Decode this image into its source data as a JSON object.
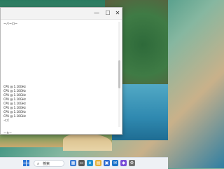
{
  "window": {
    "controls": {
      "minimize": "—",
      "maximize": "☐",
      "close": "✕"
    },
    "lines": [
      "ーバーロー",
      "",
      "",
      "",
      "",
      "",
      "",
      "",
      "",
      "",
      "",
      "",
      "",
      "",
      "",
      "CPU @ 1.10GHz",
      "CPU @ 1.10GHz",
      "CPU @ 1.10GHz",
      "CPU @ 1.10GHz",
      "CPU @ 1.10GHz",
      "CPU @ 1.10GHz",
      "CPU @ 1.10GHz",
      "CPU @ 1.10GHz",
      "イズ",
      "",
      "",
      "ーカー"
    ]
  },
  "taskbar": {
    "search_label": "検索",
    "icons": [
      {
        "name": "widgets-icon",
        "glyph": "▦",
        "color": "#3a7bd5"
      },
      {
        "name": "task-view-icon",
        "glyph": "▭",
        "color": "#5a5a5a"
      },
      {
        "name": "edge-icon",
        "glyph": "e",
        "color": "#1f8fd0"
      },
      {
        "name": "explorer-icon",
        "glyph": "▤",
        "color": "#e8b13a"
      },
      {
        "name": "store-icon",
        "glyph": "▣",
        "color": "#2e6bd0"
      },
      {
        "name": "mail-icon",
        "glyph": "✉",
        "color": "#1a73c9"
      },
      {
        "name": "app-icon",
        "glyph": "◆",
        "color": "#7a4dd8"
      },
      {
        "name": "settings-icon",
        "glyph": "⚙",
        "color": "#707070"
      }
    ]
  }
}
